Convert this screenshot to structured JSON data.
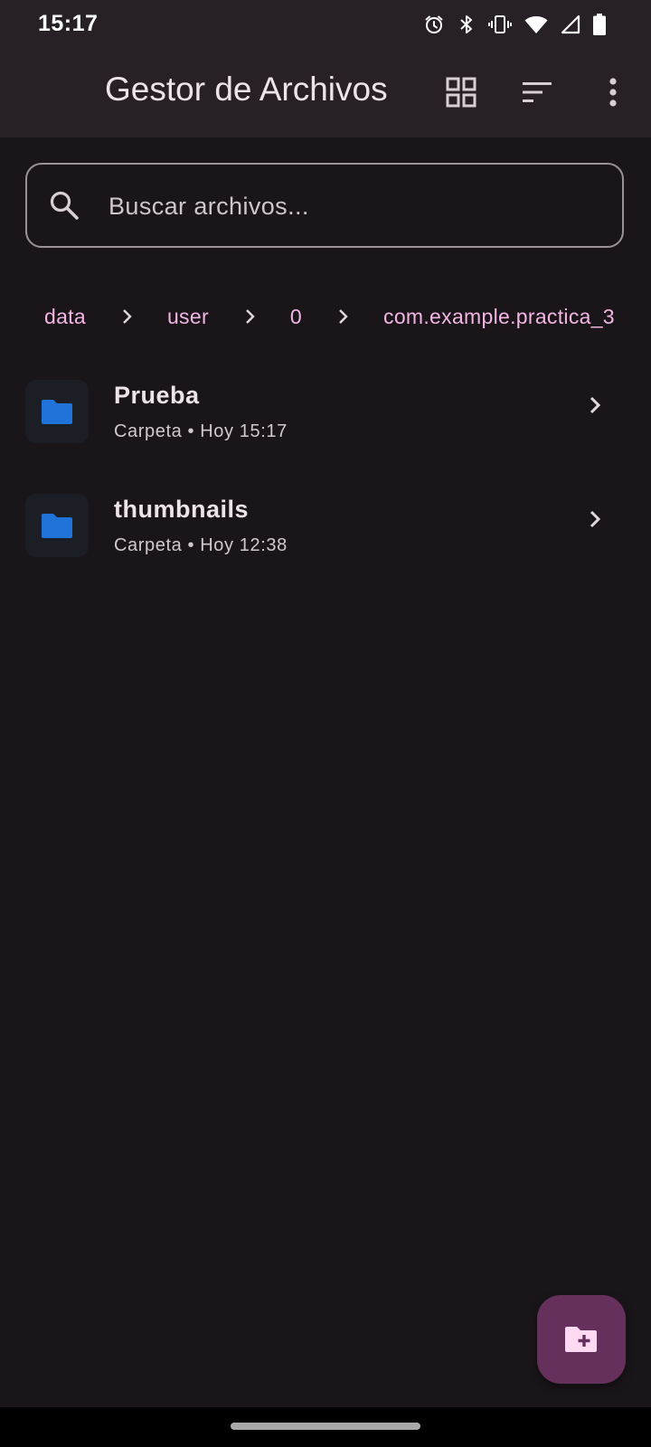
{
  "status_bar": {
    "time": "15:17",
    "icons": [
      "alarm-icon",
      "bluetooth-icon",
      "vibrate-icon",
      "wifi-icon",
      "cell-signal-icon",
      "battery-icon"
    ]
  },
  "app_bar": {
    "title": "Gestor de Archivos",
    "actions": [
      "grid-view-icon",
      "sort-icon",
      "more-vert-icon"
    ]
  },
  "search": {
    "placeholder": "Buscar archivos...",
    "value": ""
  },
  "breadcrumb": {
    "items": [
      "data",
      "user",
      "0",
      "com.example.practica_3"
    ]
  },
  "files": [
    {
      "name": "Prueba",
      "meta": "Carpeta • Hoy 15:17",
      "icon": "folder-icon"
    },
    {
      "name": "thumbnails",
      "meta": "Carpeta • Hoy 12:38",
      "icon": "folder-icon"
    }
  ],
  "fab": {
    "icon": "create-folder-icon"
  },
  "colors": {
    "background": "#1a1519",
    "app_bar": "#272026",
    "accent_text": "#f2b6e4",
    "folder_icon": "#1f73d9",
    "fab": "#66305d"
  }
}
